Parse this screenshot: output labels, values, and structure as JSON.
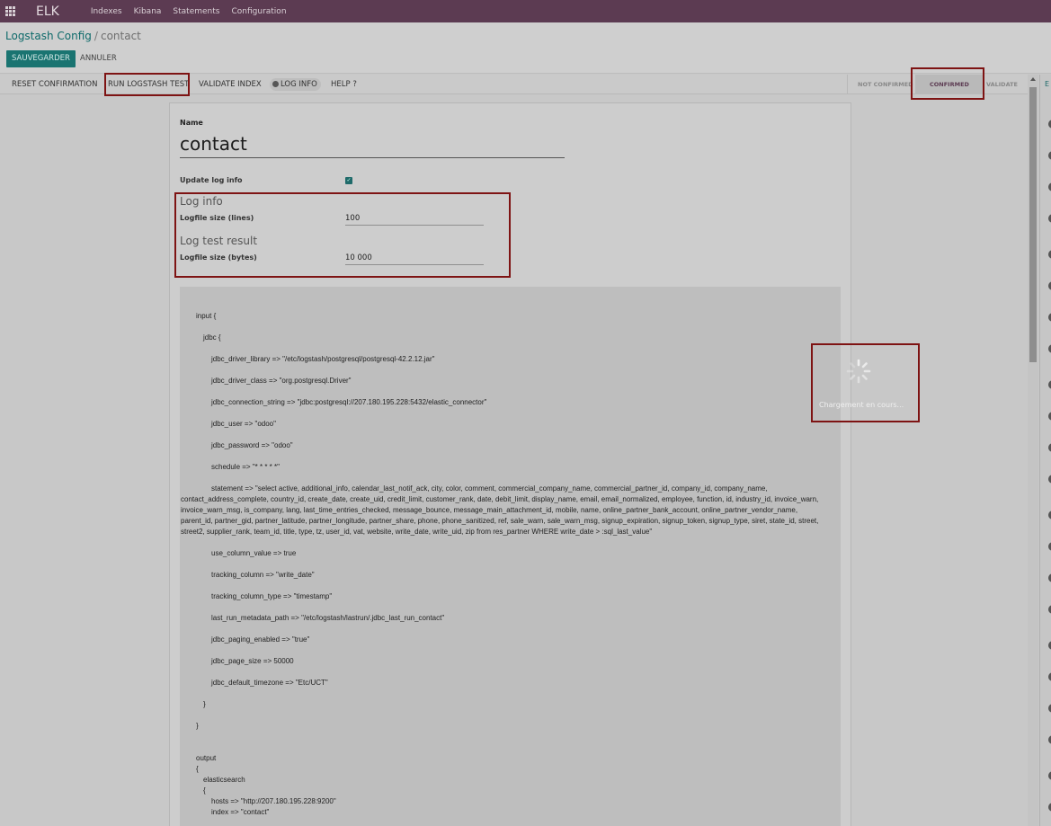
{
  "navbar": {
    "brand": "ELK",
    "menu": [
      "Indexes",
      "Kibana",
      "Statements",
      "Configuration"
    ]
  },
  "breadcrumb": {
    "root": "Logstash Config",
    "separator": "/",
    "current": "contact"
  },
  "actions": {
    "save": "SAUVEGARDER",
    "cancel": "ANNULER"
  },
  "header_buttons": {
    "reset": "RESET CONFIRMATION",
    "run_test": "RUN LOGSTASH TEST",
    "validate_index": "VALIDATE INDEX",
    "log_info": "LOG INFO",
    "help": "HELP ?"
  },
  "stages": {
    "not_confirmed": "NOT CONFIRMED",
    "confirmed": "CONFIRMED",
    "validate": "VALIDATE",
    "active": "confirmed"
  },
  "form": {
    "name_label": "Name",
    "name_value": "contact",
    "update_log_info_label": "Update log info",
    "update_log_info_checked": true,
    "log_info_title": "Log info",
    "logfile_lines_label": "Logfile size (lines)",
    "logfile_lines_value": "100",
    "log_test_result_title": "Log test result",
    "logfile_bytes_label": "Logfile size (bytes)",
    "logfile_bytes_value": "10 000"
  },
  "code_lines": [
    {
      "indent": "l1",
      "text": "input {"
    },
    {
      "indent": "l2",
      "text": "jdbc {"
    },
    {
      "indent": "l3",
      "text": "jdbc_driver_library => \"/etc/logstash/postgresql/postgresql-42.2.12.jar\""
    },
    {
      "indent": "l3",
      "text": "jdbc_driver_class => \"org.postgresql.Driver\""
    },
    {
      "indent": "l3",
      "text": "jdbc_connection_string => \"jdbc:postgresql://207.180.195.228:5432/elastic_connector\""
    },
    {
      "indent": "l3",
      "text": "jdbc_user => \"odoo\""
    },
    {
      "indent": "l3",
      "text": "jdbc_password => \"odoo\""
    },
    {
      "indent": "l3",
      "text": "schedule => \"* * * * *\""
    },
    {
      "indent": "wrap",
      "text": "statement => \"select active, additional_info, calendar_last_notif_ack, city, color, comment, commercial_company_name, commercial_partner_id, company_id, company_name, contact_address_complete, country_id, create_date, create_uid, credit_limit, customer_rank, date, debit_limit, display_name, email, email_normalized, employee, function, id, industry_id, invoice_warn, invoice_warn_msg, is_company, lang, last_time_entries_checked, message_bounce, message_main_attachment_id, mobile, name, online_partner_bank_account, online_partner_vendor_name, parent_id, partner_gid, partner_latitude, partner_longitude, partner_share, phone, phone_sanitized, ref, sale_warn, sale_warn_msg, signup_expiration, signup_token, signup_type, siret, state_id, street, street2, supplier_rank, team_id, title, type, tz, user_id, vat, website, write_date, write_uid, zip from res_partner WHERE write_date > :sql_last_value\""
    },
    {
      "indent": "l3",
      "text": "use_column_value => true"
    },
    {
      "indent": "l3",
      "text": "tracking_column => \"write_date\""
    },
    {
      "indent": "l3",
      "text": "tracking_column_type => \"timestamp\""
    },
    {
      "indent": "l3",
      "text": "last_run_metadata_path => \"/etc/logstash/lastrun/.jdbc_last_run_contact\""
    },
    {
      "indent": "l3",
      "text": "jdbc_paging_enabled => \"true\""
    },
    {
      "indent": "l3",
      "text": "jdbc_page_size => 50000"
    },
    {
      "indent": "l3",
      "text": "jdbc_default_timezone => \"Etc/UCT\""
    },
    {
      "indent": "l2",
      "text": "}"
    },
    {
      "indent": "l1",
      "text": "}"
    }
  ],
  "code_output": {
    "output": "output",
    "open_brace": "{",
    "elasticsearch": "elasticsearch",
    "es_brace": "{",
    "hosts": "hosts => \"http://207.180.195.228:9200\"",
    "index": "index => \"contact\""
  },
  "loading": {
    "text": "Chargement en cours..."
  },
  "right_panel": {
    "letter": "E"
  },
  "colors": {
    "navbar": "#5c3b52",
    "primary": "#1a7471",
    "highlight": "#7e1313"
  }
}
